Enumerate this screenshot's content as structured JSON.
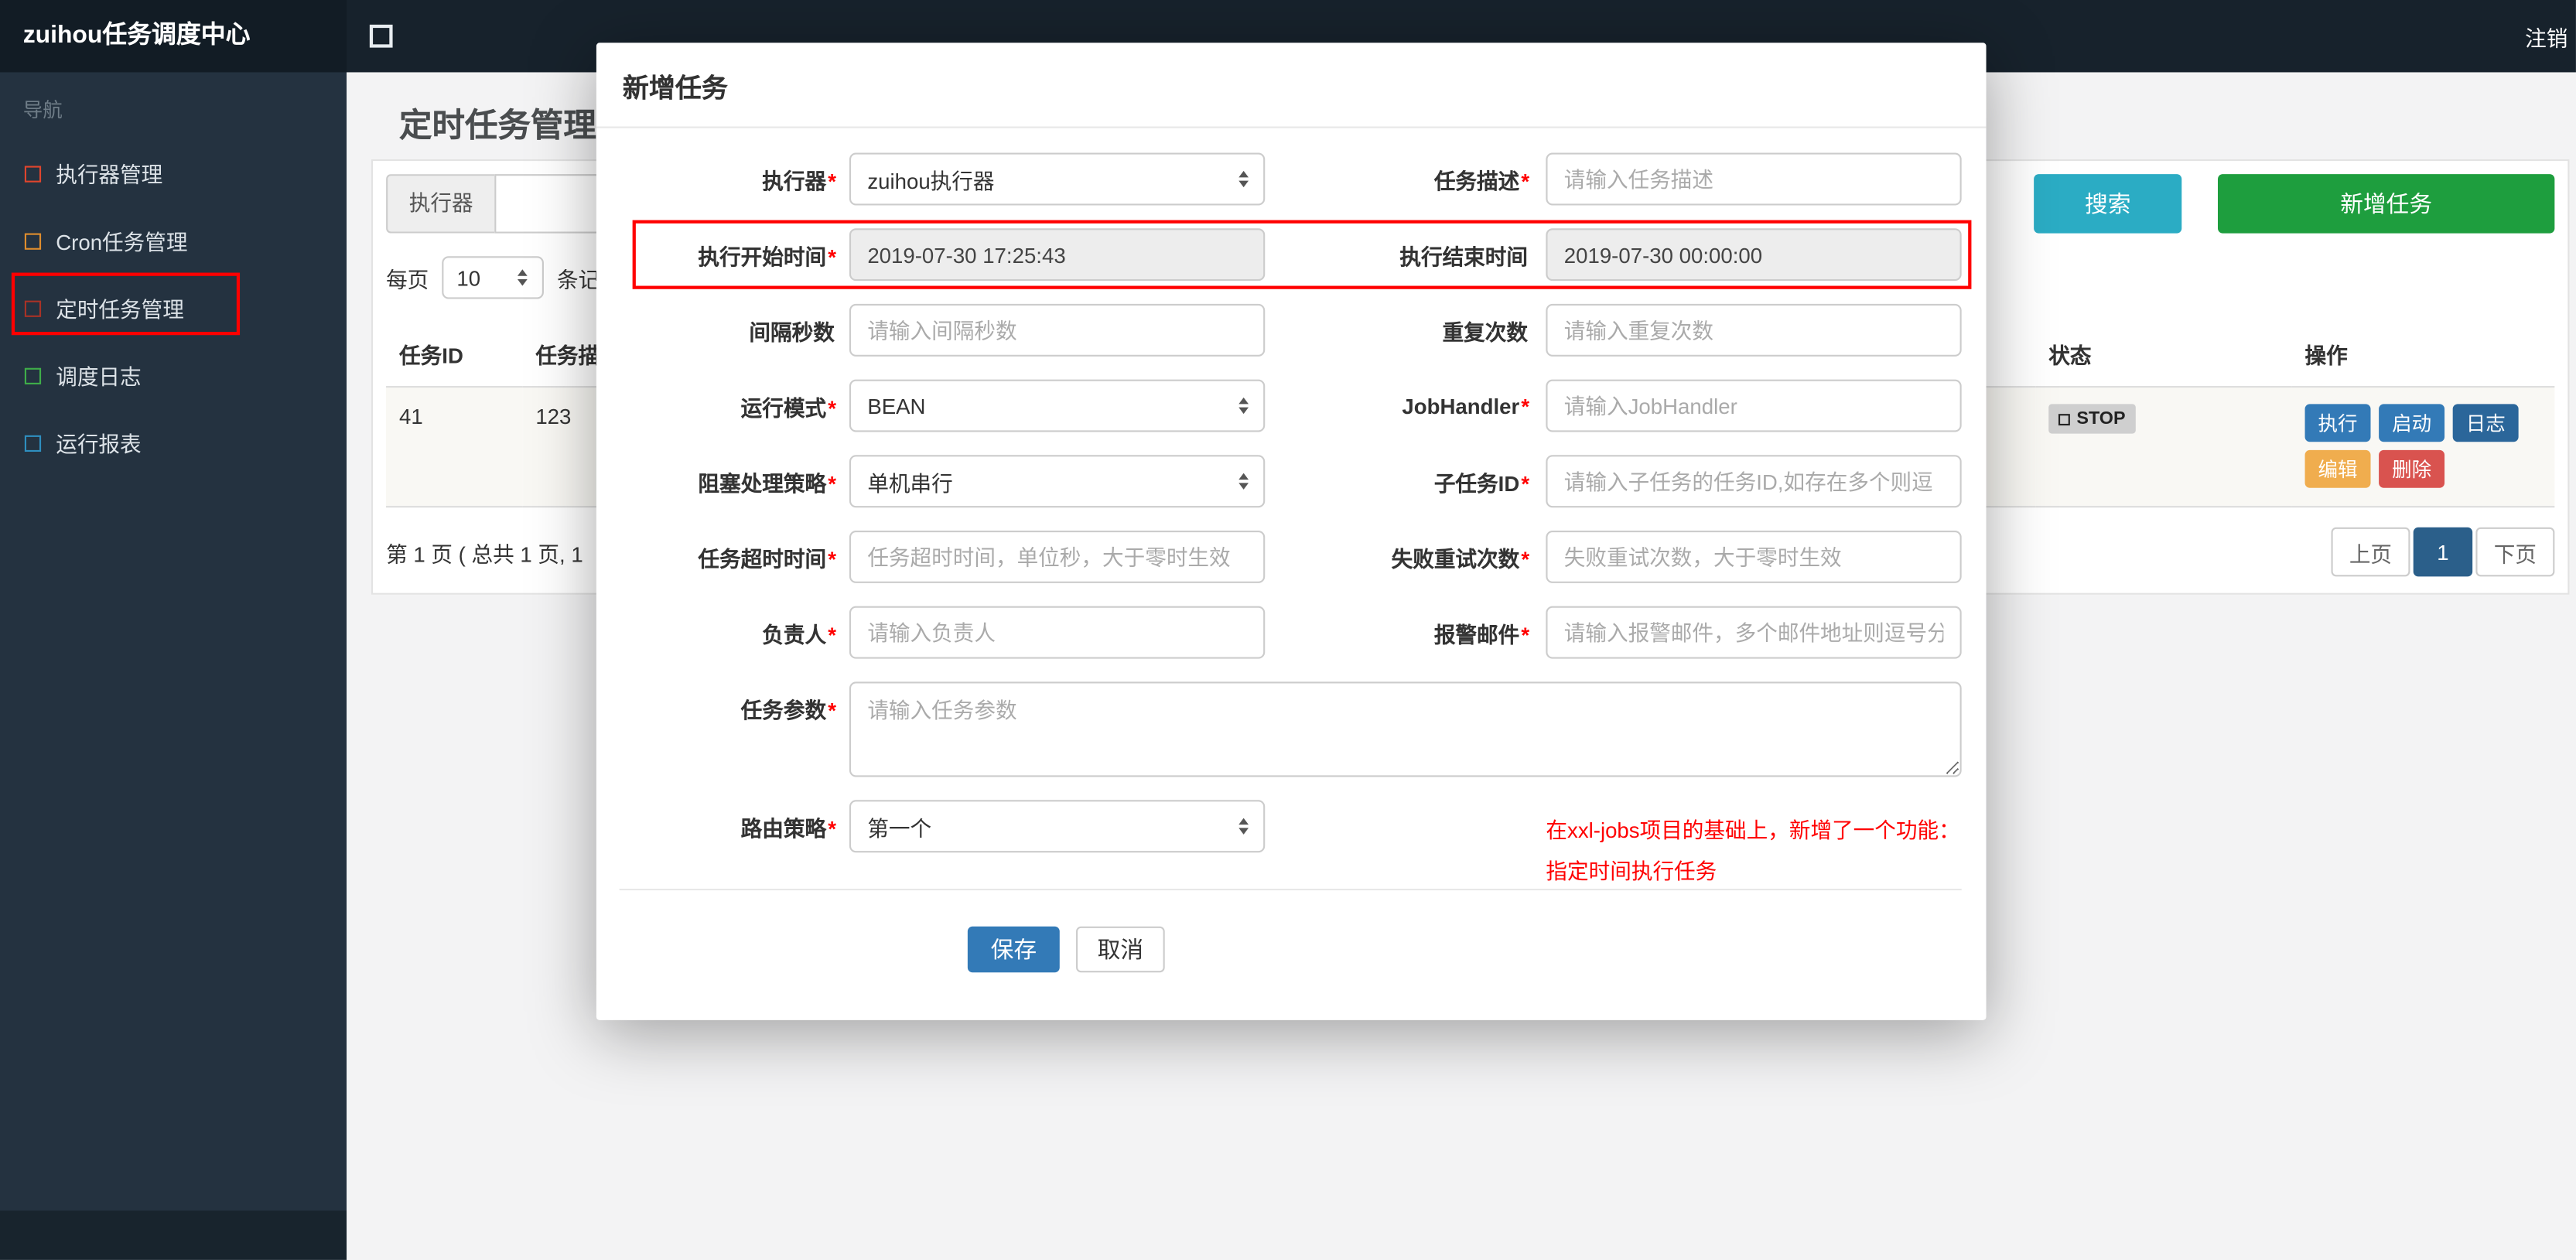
{
  "colors": {
    "accent_search": "#2bacc4",
    "accent_add": "#1e9e3e",
    "accent_save": "#337ab7",
    "pagination_active": "#2b5f8a",
    "annotation_red": "#ff0000",
    "status_stop_bg": "#cfcfcf"
  },
  "navbar": {
    "brand": "zuihou任务调度中心",
    "logout": "注销"
  },
  "sidebar": {
    "section_label": "导航",
    "items": [
      {
        "label": "执行器管理",
        "icon_style": "border-color:#e0452d"
      },
      {
        "label": "Cron任务管理",
        "icon_style": "border-color:#e08e2d"
      },
      {
        "label": "定时任务管理",
        "icon_style": "border-color:#a93226"
      },
      {
        "label": "调度日志",
        "icon_style": "border-color:#3fae49"
      },
      {
        "label": "运行报表",
        "icon_style": "border-color:#2e8fc0"
      }
    ]
  },
  "page": {
    "title": "定时任务管理",
    "filter": {
      "executor_addon": "执行器",
      "search_button": "搜索",
      "add_button": "新增任务"
    },
    "per_page": {
      "prefix": "每页",
      "value": "10",
      "suffix": "条记"
    },
    "table": {
      "headers": {
        "id": "任务ID",
        "desc": "任务描述",
        "status": "状态",
        "actions": "操作"
      },
      "row": {
        "id": "41",
        "desc": "123",
        "status": "STOP",
        "actions": {
          "run": {
            "label": "执行",
            "style": "background:#337ab7"
          },
          "start": {
            "label": "启动",
            "style": "background:#337ab7"
          },
          "log": {
            "label": "日志",
            "style": "background:#2b669a"
          },
          "edit": {
            "label": "编辑",
            "style": "background:#f0ad4e"
          },
          "delete": {
            "label": "删除",
            "style": "background:#d9534f"
          }
        }
      }
    },
    "summary": "第 1 页 ( 总共 1 页, 1",
    "pagination": {
      "prev": "上页",
      "current": "1",
      "next": "下页"
    }
  },
  "modal": {
    "title": "新增任务",
    "fields": {
      "executor": {
        "label": "执行器",
        "req": "*",
        "value": "zuihou执行器"
      },
      "job_desc": {
        "label": "任务描述",
        "req": "*",
        "placeholder": "请输入任务描述"
      },
      "start_time": {
        "label": "执行开始时间",
        "req": "*",
        "value": "2019-07-30 17:25:43"
      },
      "end_time": {
        "label": "执行结束时间",
        "req": "",
        "value": "2019-07-30 00:00:00"
      },
      "interval": {
        "label": "间隔秒数",
        "req": "",
        "placeholder": "请输入间隔秒数"
      },
      "repeat_count": {
        "label": "重复次数",
        "req": "",
        "placeholder": "请输入重复次数"
      },
      "run_mode": {
        "label": "运行模式",
        "req": "*",
        "value": "BEAN"
      },
      "job_handler": {
        "label": "JobHandler",
        "req": "*",
        "placeholder": "请输入JobHandler"
      },
      "block_strategy": {
        "label": "阻塞处理策略",
        "req": "*",
        "value": "单机串行"
      },
      "child_job": {
        "label": "子任务ID",
        "req": "*",
        "placeholder": "请输入子任务的任务ID,如存在多个则逗"
      },
      "timeout": {
        "label": "任务超时时间",
        "req": "*",
        "placeholder": "任务超时时间，单位秒，大于零时生效"
      },
      "retry": {
        "label": "失败重试次数",
        "req": "*",
        "placeholder": "失败重试次数，大于零时生效"
      },
      "owner": {
        "label": "负责人",
        "req": "*",
        "placeholder": "请输入负责人"
      },
      "alarm_email": {
        "label": "报警邮件",
        "req": "*",
        "placeholder": "请输入报警邮件，多个邮件地址则逗号分"
      },
      "job_param": {
        "label": "任务参数",
        "req": "*",
        "placeholder": "请输入任务参数"
      },
      "route_strategy": {
        "label": "路由策略",
        "req": "*",
        "value": "第一个"
      }
    },
    "note_line1": "在xxl-jobs项目的基础上，新增了一个功能：",
    "note_line2": "指定时间执行任务",
    "save": "保存",
    "cancel": "取消"
  }
}
